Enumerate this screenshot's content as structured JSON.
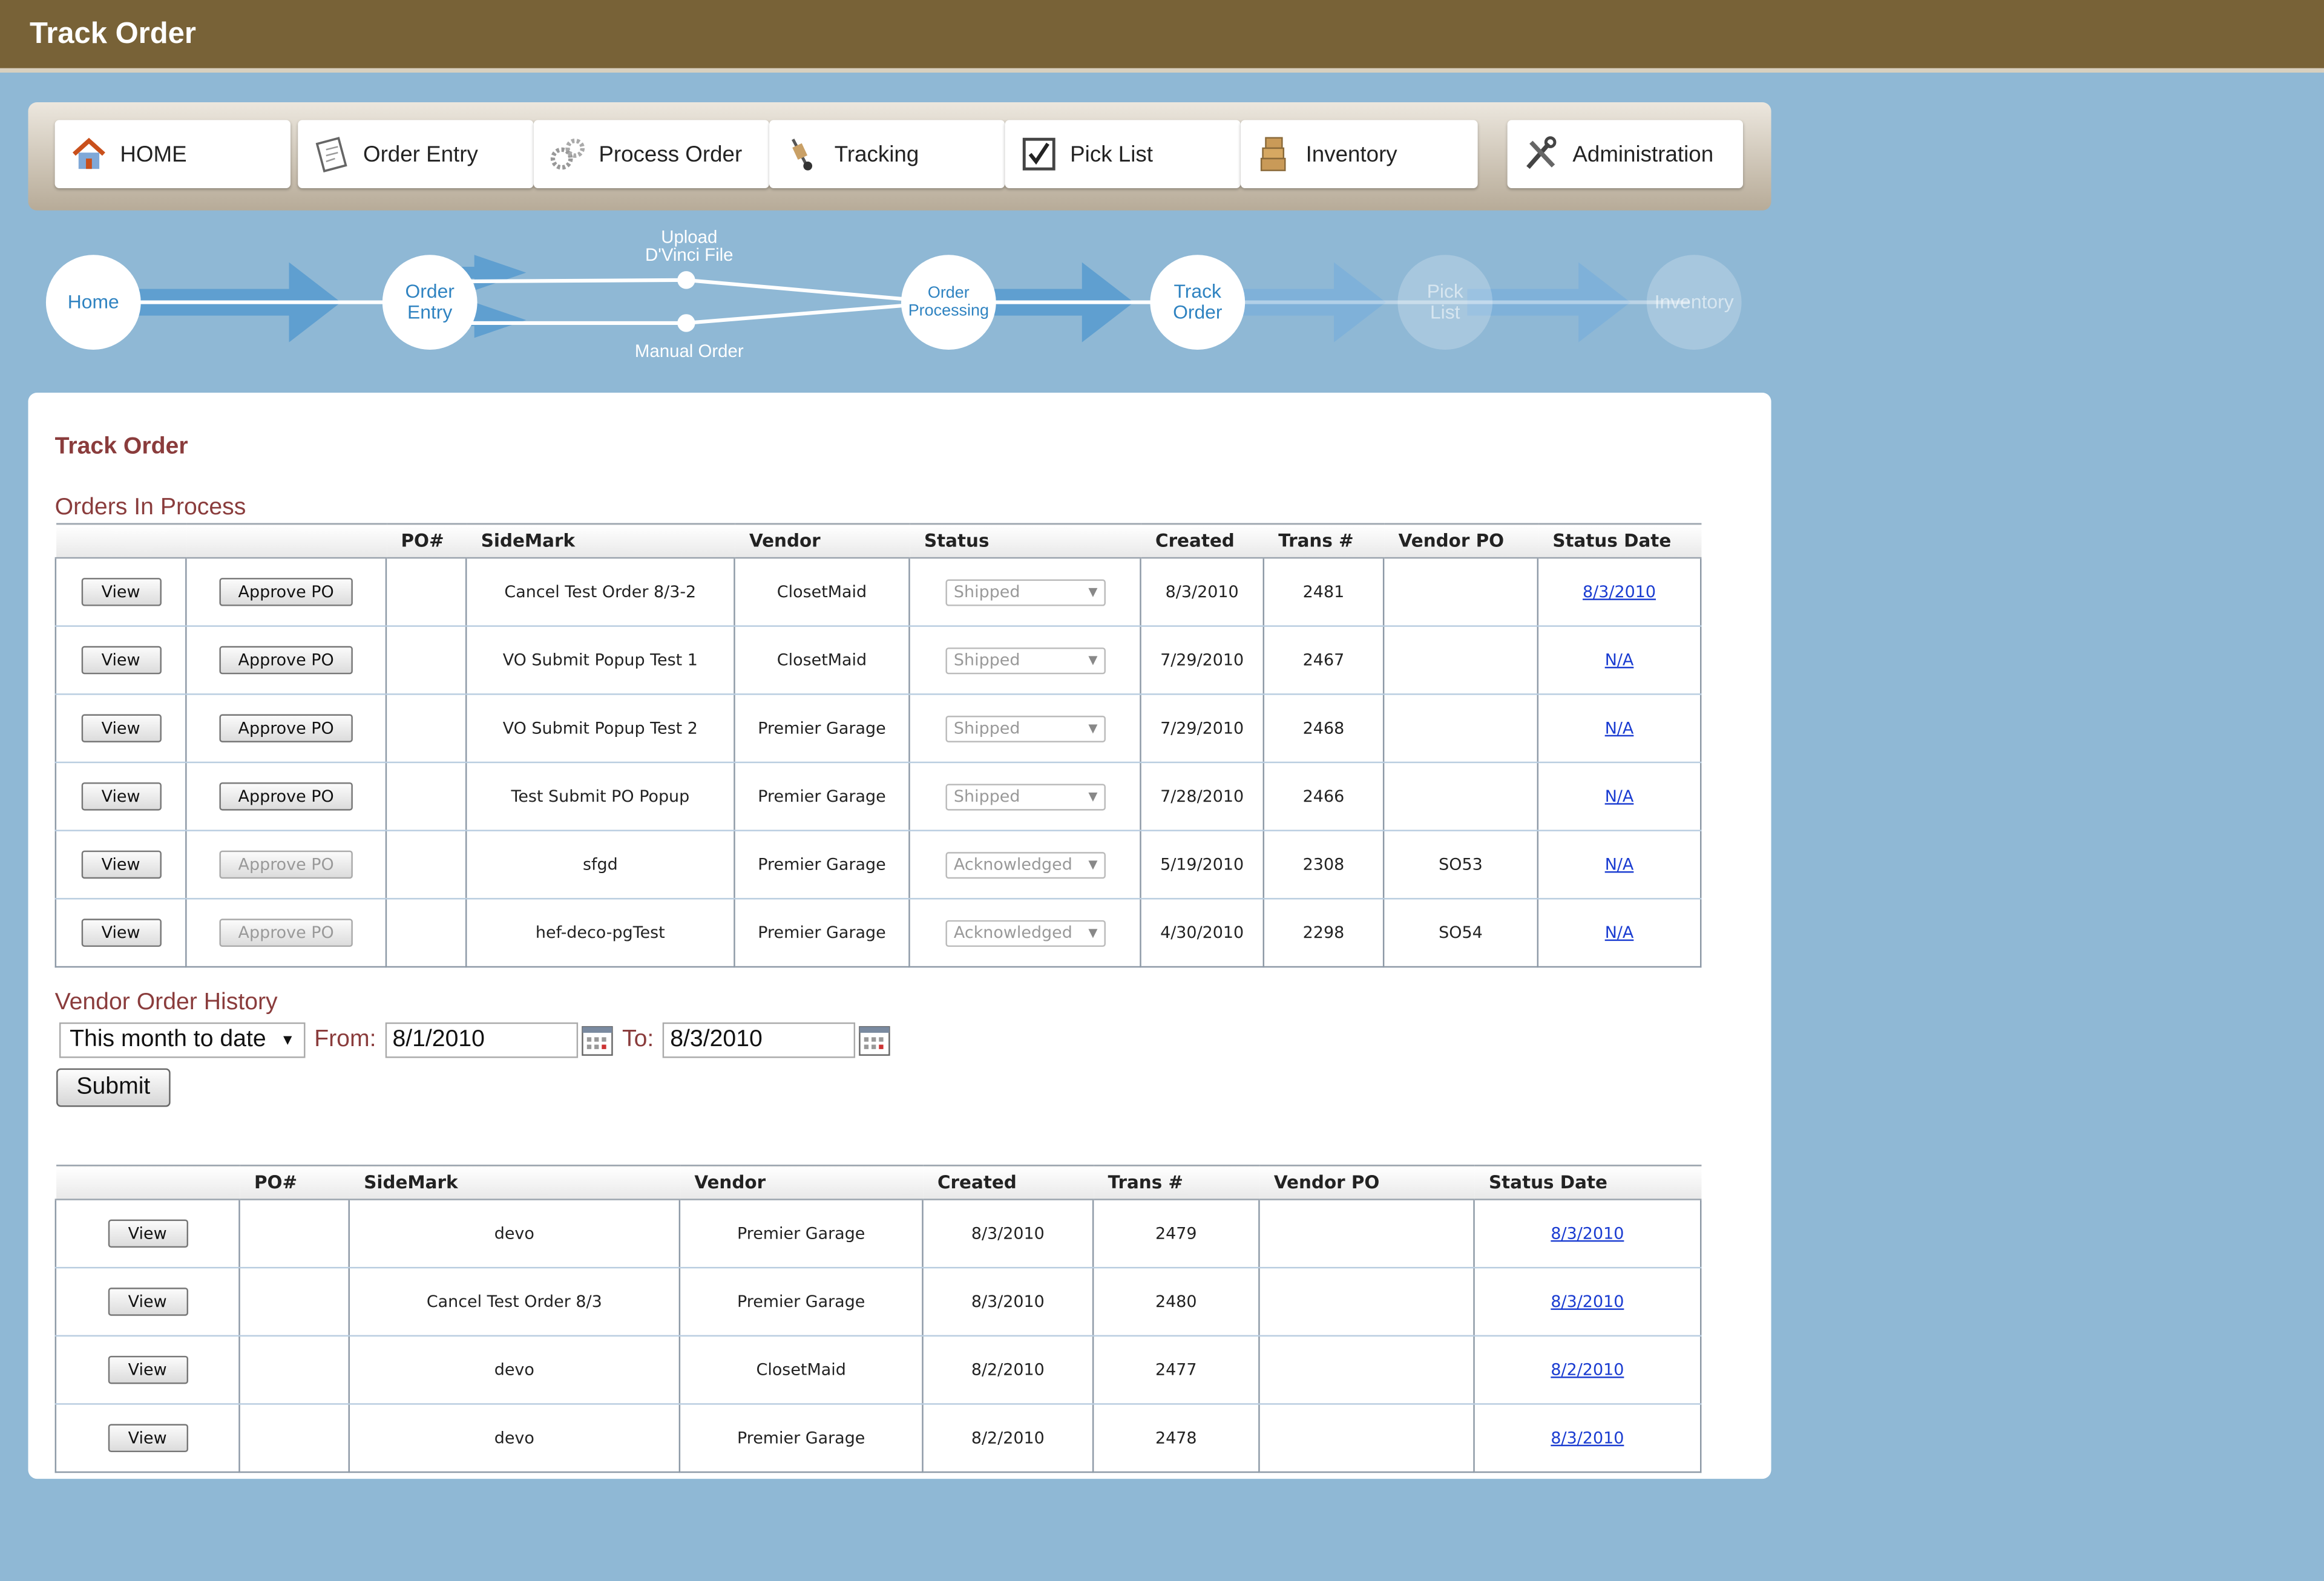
{
  "app": {
    "title": "Track Order"
  },
  "nav": [
    {
      "label": "HOME",
      "icon": "house-icon"
    },
    {
      "label": "Order Entry",
      "icon": "clipboard-icon"
    },
    {
      "label": "Process Order",
      "icon": "gears-icon"
    },
    {
      "label": "Tracking",
      "icon": "hand-truck-icon"
    },
    {
      "label": "Pick List",
      "icon": "checkbox-icon"
    },
    {
      "label": "Inventory",
      "icon": "boxes-icon"
    },
    {
      "label": "Administration",
      "icon": "tools-icon"
    }
  ],
  "workflow": {
    "home": "Home",
    "order_entry": [
      "Order",
      "Entry"
    ],
    "upload": [
      "Upload",
      "D'Vinci File"
    ],
    "manual": "Manual Order",
    "processing": [
      "Order",
      "Processing"
    ],
    "track": [
      "Track",
      "Order"
    ],
    "pick": [
      "Pick",
      "List"
    ],
    "inventory": "Inventory"
  },
  "page": {
    "heading": "Track Order",
    "in_process_title": "Orders In Process",
    "history_title": "Vendor Order History"
  },
  "in_process": {
    "headers": [
      "",
      "",
      "PO#",
      "SideMark",
      "Vendor",
      "Status",
      "Created",
      "Trans #",
      "Vendor PO",
      "Status Date"
    ],
    "view_label": "View",
    "approve_label": "Approve PO",
    "rows": [
      {
        "po": "",
        "sidemark": "Cancel Test Order 8/3-2",
        "vendor": "ClosetMaid",
        "status": "Shipped",
        "created": "8/3/2010",
        "trans": "2481",
        "vendor_po": "",
        "status_date": "8/3/2010",
        "approve_enabled": true
      },
      {
        "po": "",
        "sidemark": "VO Submit Popup Test 1",
        "vendor": "ClosetMaid",
        "status": "Shipped",
        "created": "7/29/2010",
        "trans": "2467",
        "vendor_po": "",
        "status_date": "N/A",
        "approve_enabled": true
      },
      {
        "po": "",
        "sidemark": "VO Submit Popup Test 2",
        "vendor": "Premier Garage",
        "status": "Shipped",
        "created": "7/29/2010",
        "trans": "2468",
        "vendor_po": "",
        "status_date": "N/A",
        "approve_enabled": true
      },
      {
        "po": "",
        "sidemark": "Test Submit PO Popup",
        "vendor": "Premier Garage",
        "status": "Shipped",
        "created": "7/28/2010",
        "trans": "2466",
        "vendor_po": "",
        "status_date": "N/A",
        "approve_enabled": true
      },
      {
        "po": "",
        "sidemark": "sfgd",
        "vendor": "Premier Garage",
        "status": "Acknowledged",
        "created": "5/19/2010",
        "trans": "2308",
        "vendor_po": "SO53",
        "status_date": "N/A",
        "approve_enabled": false
      },
      {
        "po": "",
        "sidemark": "hef-deco-pgTest",
        "vendor": "Premier Garage",
        "status": "Acknowledged",
        "created": "4/30/2010",
        "trans": "2298",
        "vendor_po": "SO54",
        "status_date": "N/A",
        "approve_enabled": false
      }
    ]
  },
  "filter": {
    "range": "This month to date",
    "from_label": "From:",
    "from_value": "8/1/2010",
    "to_label": "To:",
    "to_value": "8/3/2010",
    "submit_label": "Submit"
  },
  "history": {
    "headers": [
      "",
      "PO#",
      "SideMark",
      "Vendor",
      "Created",
      "Trans #",
      "Vendor PO",
      "Status Date"
    ],
    "view_label": "View",
    "rows": [
      {
        "po": "",
        "sidemark": "devo",
        "vendor": "Premier Garage",
        "created": "8/3/2010",
        "trans": "2479",
        "vendor_po": "",
        "status_date": "8/3/2010"
      },
      {
        "po": "",
        "sidemark": "Cancel Test Order 8/3",
        "vendor": "Premier Garage",
        "created": "8/3/2010",
        "trans": "2480",
        "vendor_po": "",
        "status_date": "8/3/2010"
      },
      {
        "po": "",
        "sidemark": "devo",
        "vendor": "ClosetMaid",
        "created": "8/2/2010",
        "trans": "2477",
        "vendor_po": "",
        "status_date": "8/2/2010"
      },
      {
        "po": "",
        "sidemark": "devo",
        "vendor": "Premier Garage",
        "created": "8/2/2010",
        "trans": "2478",
        "vendor_po": "",
        "status_date": "8/3/2010"
      }
    ]
  },
  "colors": {
    "background": "#8fb8d5",
    "topbar": "#786237",
    "heading": "#8a3c3c",
    "link": "#1a3cd1",
    "workflow_node_text": "#2f83c1"
  }
}
